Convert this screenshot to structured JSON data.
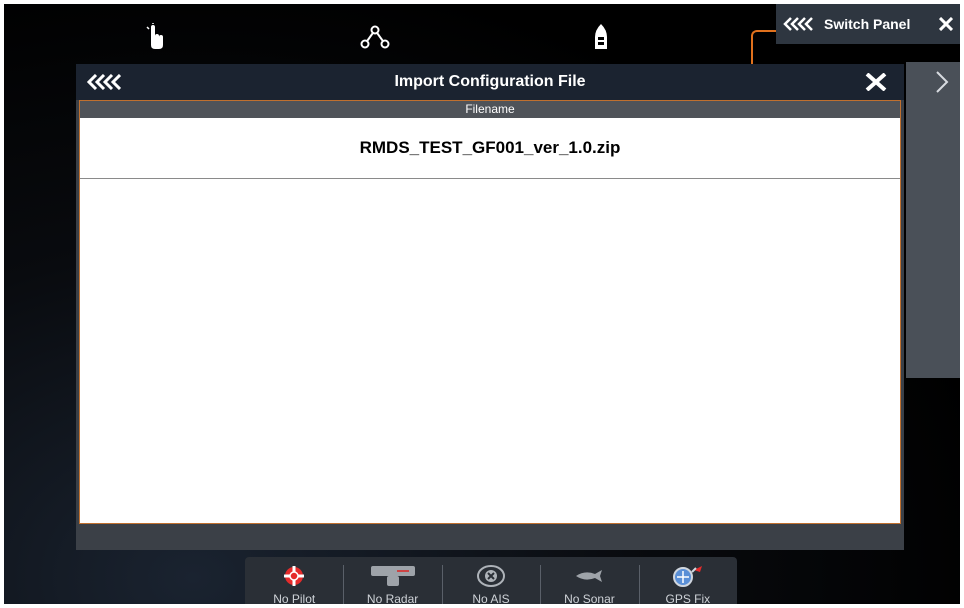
{
  "top_bar": {
    "icons": [
      "touch-hand-icon",
      "route-waypoints-icon",
      "boat-icon"
    ]
  },
  "switch_panel": {
    "title": "Switch Panel"
  },
  "dialog": {
    "title": "Import Configuration File",
    "column_header": "Filename",
    "files": [
      "RMDS_TEST_GF001_ver_1.0.zip"
    ]
  },
  "status_bar": {
    "items": [
      {
        "label": "No Pilot",
        "icon": "pilot-icon"
      },
      {
        "label": "No Radar",
        "icon": "radar-icon"
      },
      {
        "label": "No AIS",
        "icon": "ais-icon"
      },
      {
        "label": "No Sonar",
        "icon": "fish-sonar-icon"
      },
      {
        "label": "GPS Fix",
        "icon": "gps-satellite-icon"
      }
    ]
  },
  "colors": {
    "accent_orange": "#e0711d",
    "dialog_header": "#1b2330",
    "dialog_body": "#3b4047"
  }
}
